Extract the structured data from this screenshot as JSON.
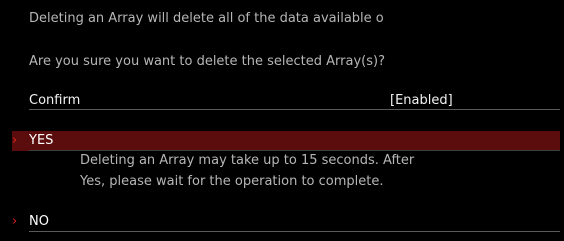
{
  "dialog": {
    "warning_text": "Deleting an Array will delete all of the data available o",
    "question_text": "Are you sure you want to delete the selected Array(s)?",
    "confirm": {
      "label": "Confirm",
      "value": "[Enabled]"
    },
    "options": [
      {
        "label": "YES",
        "selected": true,
        "help_line_1": "Deleting an Array may take up to 15 seconds. After",
        "help_line_2": "Yes, please wait for the operation to complete."
      },
      {
        "label": "NO",
        "selected": false
      }
    ],
    "colors": {
      "background": "#000000",
      "selected_row": "#5b0c0c",
      "arrow": "#e1241f",
      "text_muted": "#b6b6b6",
      "text_bright": "#f2f2f2"
    },
    "icons": {
      "option_pointer": "chevron-right-icon"
    }
  }
}
